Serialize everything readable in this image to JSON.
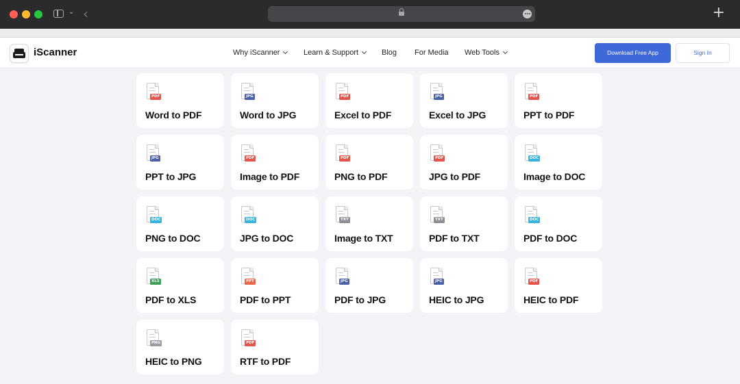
{
  "brand": {
    "name": "iScanner"
  },
  "nav": {
    "items": [
      {
        "label": "Why iScanner",
        "has_dropdown": true
      },
      {
        "label": "Learn & Support",
        "has_dropdown": true
      },
      {
        "label": "Blog",
        "has_dropdown": false
      },
      {
        "label": "For Media",
        "has_dropdown": false
      },
      {
        "label": "Web Tools",
        "has_dropdown": true
      }
    ],
    "download_label": "Download Free App",
    "signin_label": "Sign In"
  },
  "colors": {
    "accent": "#3f68d8",
    "pdf": "#e5534b",
    "jpg": "#4a5fa8",
    "doc": "#36b3de",
    "txt": "#8d8f96",
    "xls": "#3f9e55",
    "ppt": "#e8664a",
    "png": "#9a9ca3"
  },
  "tools": [
    {
      "label": "Word to PDF",
      "icon": "PDF"
    },
    {
      "label": "Word to JPG",
      "icon": "JPG"
    },
    {
      "label": "Excel to PDF",
      "icon": "PDF"
    },
    {
      "label": "Excel to JPG",
      "icon": "JPG"
    },
    {
      "label": "PPT to PDF",
      "icon": "PDF"
    },
    {
      "label": "PPT to JPG",
      "icon": "JPG"
    },
    {
      "label": "Image to PDF",
      "icon": "PDF"
    },
    {
      "label": "PNG to PDF",
      "icon": "PDF"
    },
    {
      "label": "JPG to PDF",
      "icon": "PDF"
    },
    {
      "label": "Image to DOC",
      "icon": "DOC"
    },
    {
      "label": "PNG to DOC",
      "icon": "DOC"
    },
    {
      "label": "JPG to DOC",
      "icon": "DOC"
    },
    {
      "label": "Image to TXT",
      "icon": "TXT"
    },
    {
      "label": "PDF to TXT",
      "icon": "TXT"
    },
    {
      "label": "PDF to DOC",
      "icon": "DOC"
    },
    {
      "label": "PDF to XLS",
      "icon": "XLS"
    },
    {
      "label": "PDF to PPT",
      "icon": "PPT"
    },
    {
      "label": "PDF to JPG",
      "icon": "JPG"
    },
    {
      "label": "HEIC to JPG",
      "icon": "JPG"
    },
    {
      "label": "HEIC to PDF",
      "icon": "PDF"
    },
    {
      "label": "HEIC to PNG",
      "icon": "PNG"
    },
    {
      "label": "RTF to PDF",
      "icon": "PDF"
    }
  ]
}
